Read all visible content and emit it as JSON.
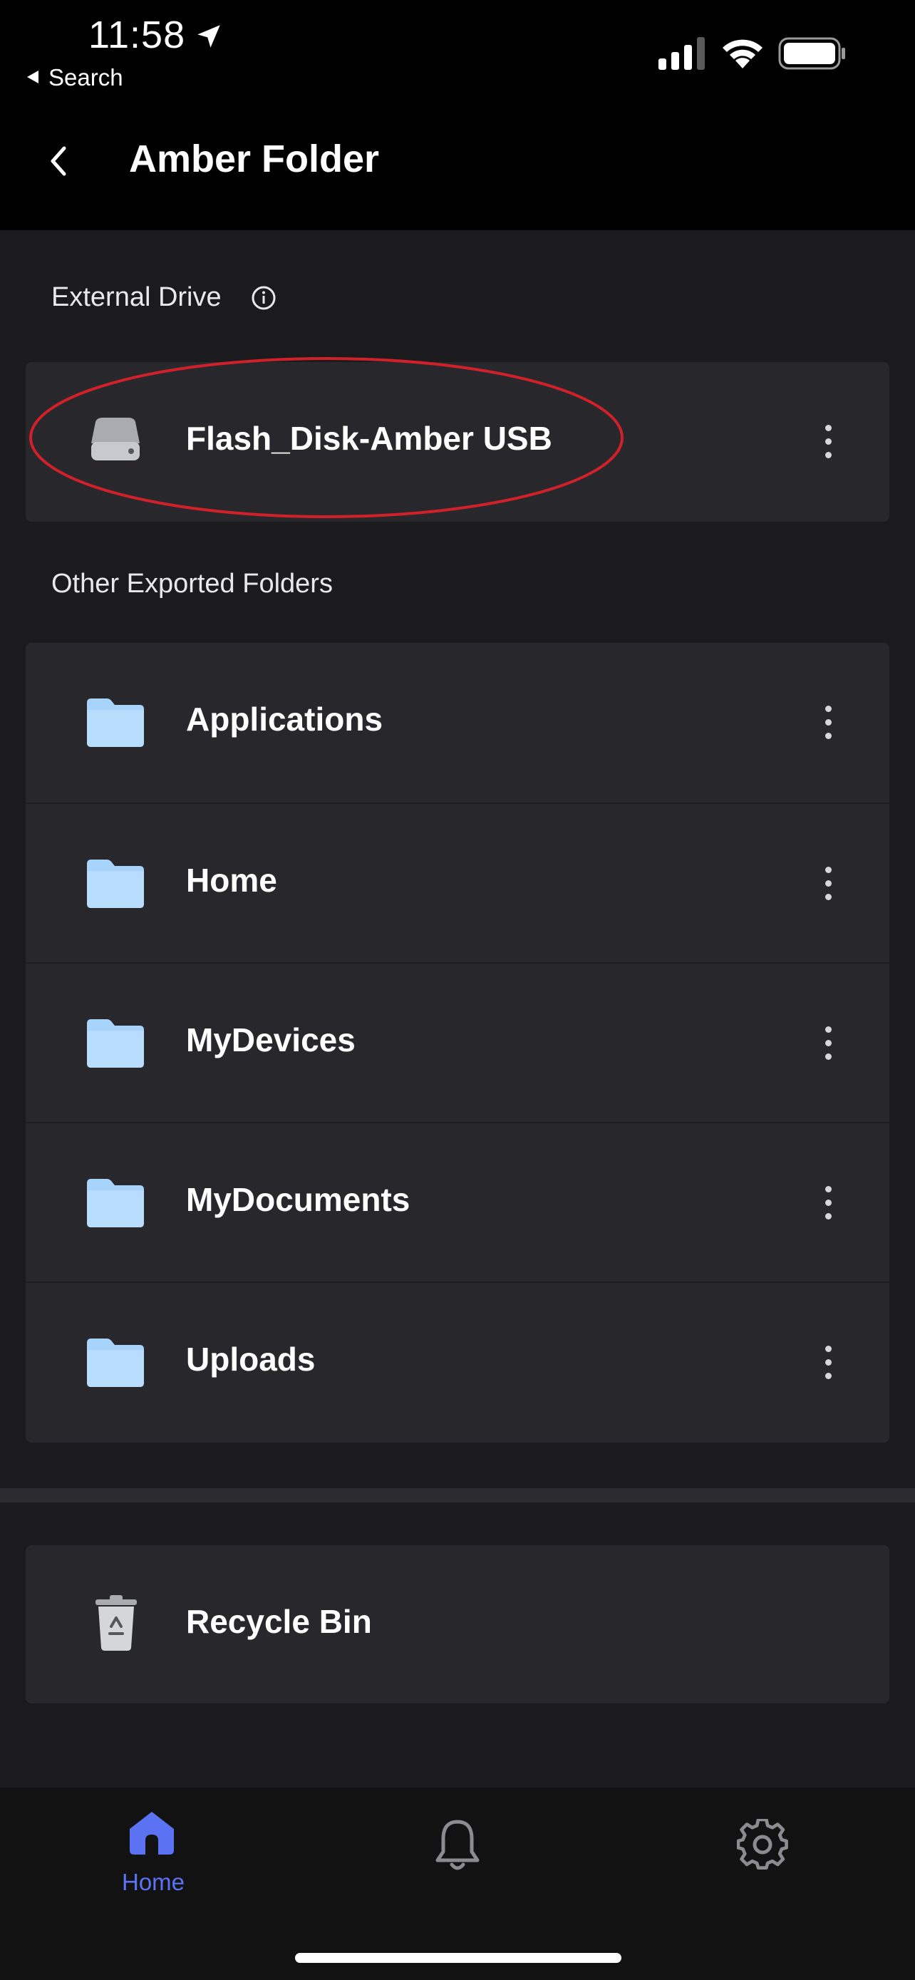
{
  "status_bar": {
    "time": "11:58",
    "back_app": "Search"
  },
  "header": {
    "title": "Amber Folder"
  },
  "external": {
    "section_label": "External Drive",
    "items": [
      {
        "name": "Flash_Disk-Amber USB",
        "icon": "drive-icon"
      }
    ]
  },
  "exported": {
    "section_label": "Other Exported Folders",
    "items": [
      {
        "name": "Applications",
        "icon": "folder-icon"
      },
      {
        "name": "Home",
        "icon": "folder-icon"
      },
      {
        "name": "MyDevices",
        "icon": "folder-icon"
      },
      {
        "name": "MyDocuments",
        "icon": "folder-icon"
      },
      {
        "name": "Uploads",
        "icon": "folder-icon"
      }
    ]
  },
  "recycle": {
    "label": "Recycle Bin",
    "icon": "trash-icon"
  },
  "tabbar": {
    "tabs": [
      {
        "label": "Home",
        "icon": "home-icon",
        "active": true
      },
      {
        "label": "",
        "icon": "bell-icon",
        "active": false
      },
      {
        "label": "",
        "icon": "gear-icon",
        "active": false
      }
    ]
  },
  "colors": {
    "accent": "#5b72f2",
    "folder": "#a8d4fb",
    "highlight_ellipse": "#d0202a",
    "card_bg": "#28282c",
    "page_bg": "#1b1b1d"
  }
}
